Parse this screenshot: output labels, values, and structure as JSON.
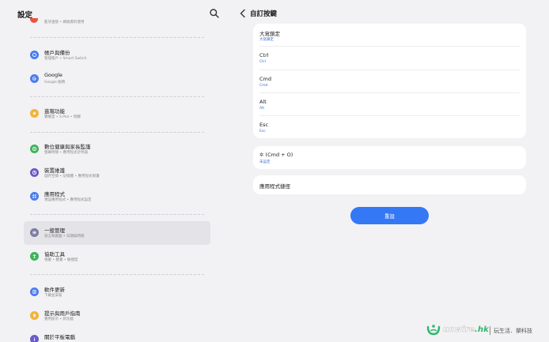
{
  "left": {
    "title": "設定",
    "partial_item": {
      "subtitle": "藍牙連接 • 網絡資料使用"
    },
    "items": [
      {
        "title": "帳戶與備份",
        "subtitle": "管理帳戶 • Smart Switch",
        "color": "#4a7df0",
        "icon": "cloud-sync-icon"
      },
      {
        "title": "Google",
        "subtitle": "Google 服務",
        "color": "#4a7df0",
        "icon": "google-icon"
      },
      {
        "title": "進階功能",
        "subtitle": "實驗室 • S Pen • 側鍵",
        "color": "#f2b33d",
        "icon": "star-gear-icon"
      },
      {
        "title": "數位健康與家長監護",
        "subtitle": "螢幕時間 • 應用程式計時器",
        "color": "#3cb55a",
        "icon": "wellbeing-icon"
      },
      {
        "title": "裝置維護",
        "subtitle": "儲存空間 • 記憶體 • 應用程式保護",
        "color": "#6a5ac8",
        "icon": "device-care-icon"
      },
      {
        "title": "應用程式",
        "subtitle": "預設應用程式 • 應用程式設定",
        "color": "#4a7df0",
        "icon": "apps-icon"
      },
      {
        "title": "一般管理",
        "subtitle": "語言和鍵盤 • 日期與時間",
        "color": "#7c7ca0",
        "icon": "general-management-icon"
      },
      {
        "title": "協助工具",
        "subtitle": "視覺 • 聽覺 • 敏捷度",
        "color": "#3cb55a",
        "icon": "accessibility-icon"
      },
      {
        "title": "軟件更新",
        "subtitle": "下載並安裝",
        "color": "#4a7df0",
        "icon": "software-update-icon"
      },
      {
        "title": "提示與用戶指南",
        "subtitle": "實用提示 • 新功能",
        "color": "#f2b33d",
        "icon": "tips-bulb-icon"
      },
      {
        "title": "關於平板電腦",
        "subtitle": "",
        "color": "#6a5ac8",
        "icon": "info-icon"
      }
    ]
  },
  "right": {
    "title": "自訂按鍵",
    "keys": [
      {
        "title": "大寫鎖定",
        "subtitle": "大寫鎖定"
      },
      {
        "title": "Ctrl",
        "subtitle": "Ctrl"
      },
      {
        "title": "Cmd",
        "subtitle": "Cmd"
      },
      {
        "title": "Alt",
        "subtitle": "Alt"
      },
      {
        "title": "Esc",
        "subtitle": "Esc"
      }
    ],
    "shortcut": {
      "title": "(Cmd + O)",
      "subtitle": "未設定"
    },
    "app_shortcuts": {
      "title": "應用程式捷徑"
    },
    "reset_label": "重設"
  },
  "watermark": {
    "brand": "unwire",
    "tld": ".hk",
    "slogan": "玩生活．樂科技"
  }
}
